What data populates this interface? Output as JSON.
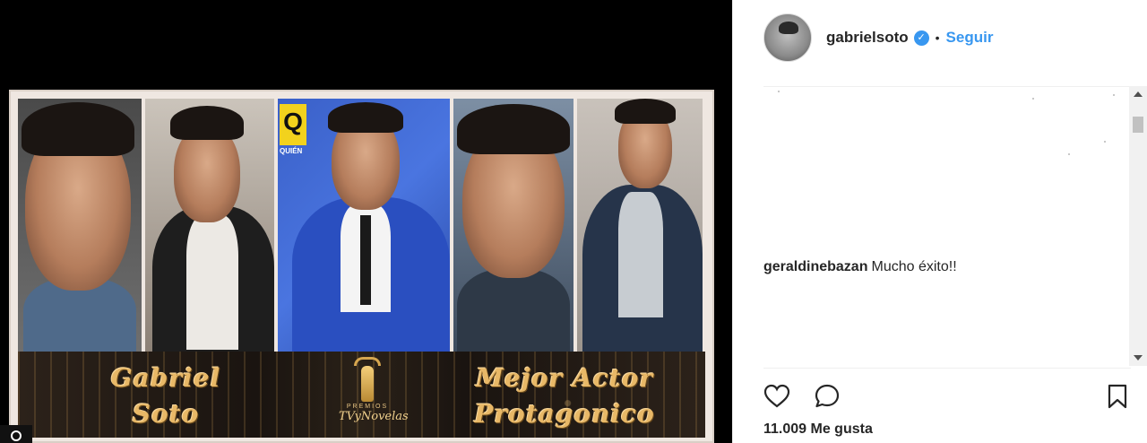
{
  "media": {
    "banner_left": [
      "Gabriel",
      "Soto"
    ],
    "banner_right": [
      "Mejor Actor",
      "Protagonico"
    ],
    "award": {
      "top": "PREMIOS",
      "name": "TVyNovelas"
    },
    "magazine": {
      "logo": "Q",
      "text": "QUIÉN"
    }
  },
  "header": {
    "username": "gabrielsoto",
    "verified": true,
    "separator": "•",
    "follow_label": "Seguir"
  },
  "comments": [
    {
      "username": "geraldinebazan",
      "text": "Mucho éxito!!"
    }
  ],
  "actions": {
    "like_icon": "heart-icon",
    "comment_icon": "comment-icon",
    "save_icon": "bookmark-icon"
  },
  "likes": {
    "text": "11.009 Me gusta"
  },
  "colors": {
    "accent": "#3897f0",
    "text": "#262626",
    "banner_gold": "#e8b867"
  }
}
